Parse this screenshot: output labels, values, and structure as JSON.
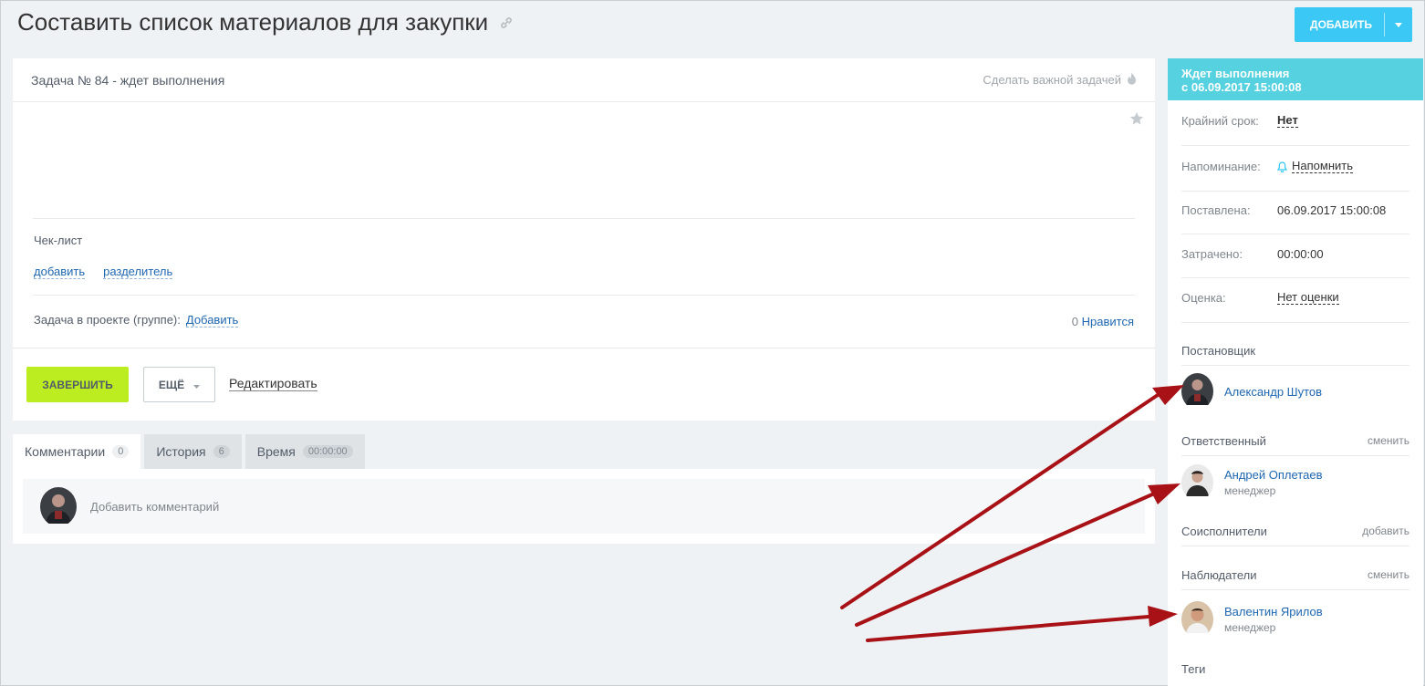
{
  "page": {
    "title": "Составить список материалов для закупки",
    "add_button": "ДОБАВИТЬ"
  },
  "task": {
    "status_line": "Задача № 84 - ждет выполнения",
    "make_important": "Сделать важной задачей",
    "checklist_title": "Чек-лист",
    "checklist_add": "добавить",
    "checklist_separator": "разделитель",
    "project_label": "Задача в проекте (группе):",
    "project_add": "Добавить",
    "likes_count": "0",
    "likes_label": "Нравится",
    "complete_button": "ЗАВЕРШИТЬ",
    "more_button": "ЕЩЁ",
    "edit_link": "Редактировать"
  },
  "tabs": [
    {
      "label": "Комментарии",
      "count": "0"
    },
    {
      "label": "История",
      "count": "6"
    },
    {
      "label": "Время",
      "count": "00:00:00"
    }
  ],
  "comment": {
    "placeholder": "Добавить комментарий"
  },
  "sidebar": {
    "status_title": "Ждет выполнения",
    "status_since": "с 06.09.2017 15:00:08",
    "rows": [
      {
        "key": "Крайний срок:",
        "value": "Нет"
      },
      {
        "key": "Напоминание:",
        "value": "Напомнить"
      },
      {
        "key": "Поставлена:",
        "value": "06.09.2017 15:00:08"
      },
      {
        "key": "Затрачено:",
        "value": "00:00:00"
      },
      {
        "key": "Оценка:",
        "value": "Нет оценки"
      }
    ],
    "creator_title": "Постановщик",
    "creator_name": "Александр Шутов",
    "responsible_title": "Ответственный",
    "responsible_action": "сменить",
    "responsible_name": "Андрей Оплетаев",
    "responsible_role": "менеджер",
    "coexec_title": "Соисполнители",
    "coexec_action": "добавить",
    "observers_title": "Наблюдатели",
    "observers_action": "сменить",
    "observer_name": "Валентин Ярилов",
    "observer_role": "менеджер",
    "tags_title": "Теги"
  },
  "colors": {
    "accent": "#3bc8f5",
    "complete": "#bbed21",
    "status_header": "#56d1e0",
    "link": "#2067b0",
    "annotation_arrow": "#a81116"
  }
}
